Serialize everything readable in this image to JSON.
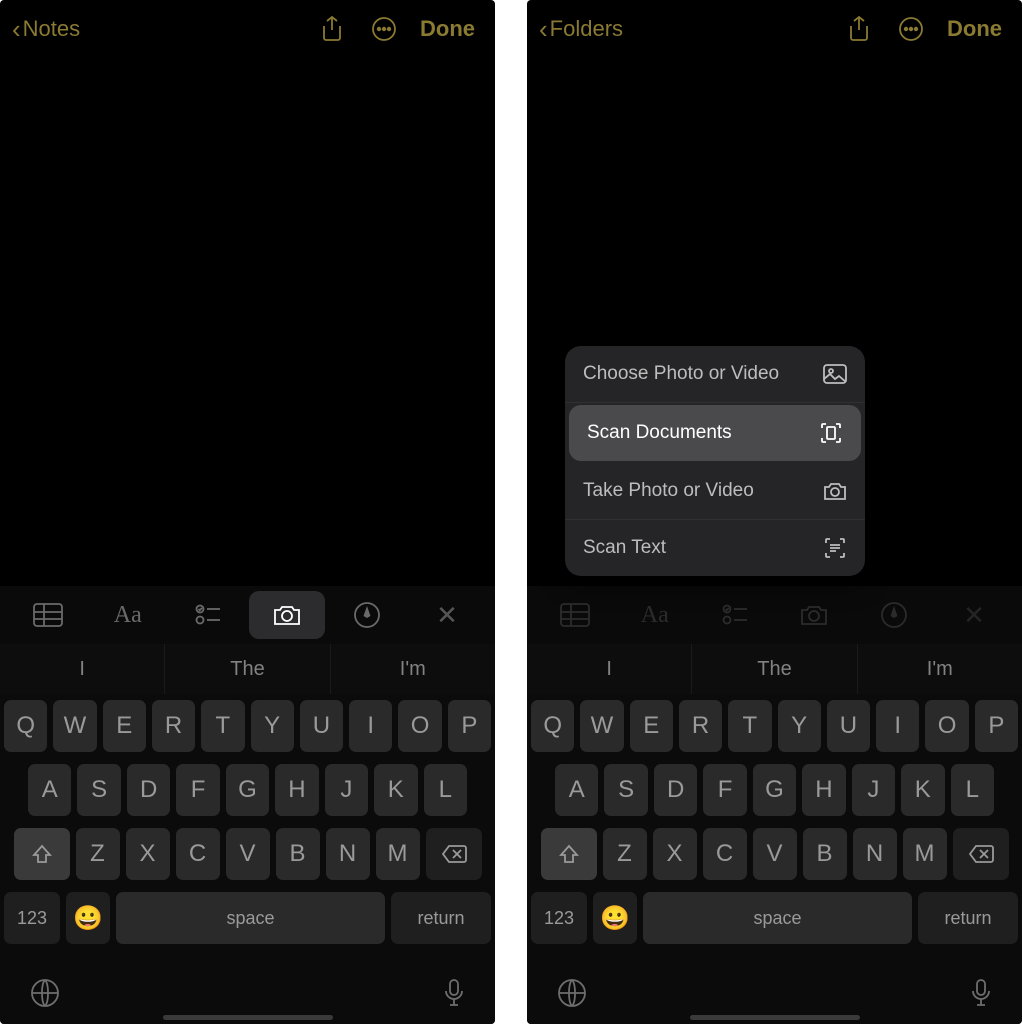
{
  "colors": {
    "accent": "#8a7a32"
  },
  "left": {
    "nav": {
      "back_label": "Notes",
      "done_label": "Done"
    }
  },
  "right": {
    "nav": {
      "back_label": "Folders",
      "done_label": "Done"
    },
    "menu": {
      "items": [
        {
          "label": "Choose Photo or Video",
          "icon": "photo-icon",
          "highlight": false
        },
        {
          "label": "Scan Documents",
          "icon": "scan-doc-icon",
          "highlight": true
        },
        {
          "label": "Take Photo or Video",
          "icon": "camera-icon",
          "highlight": false
        },
        {
          "label": "Scan Text",
          "icon": "scan-text-icon",
          "highlight": false
        }
      ]
    }
  },
  "predictions": [
    "I",
    "The",
    "I'm"
  ],
  "keyboard": {
    "row1": [
      "Q",
      "W",
      "E",
      "R",
      "T",
      "Y",
      "U",
      "I",
      "O",
      "P"
    ],
    "row2": [
      "A",
      "S",
      "D",
      "F",
      "G",
      "H",
      "J",
      "K",
      "L"
    ],
    "row3": [
      "Z",
      "X",
      "C",
      "V",
      "B",
      "N",
      "M"
    ],
    "numbers_label": "123",
    "space_label": "space",
    "return_label": "return"
  }
}
